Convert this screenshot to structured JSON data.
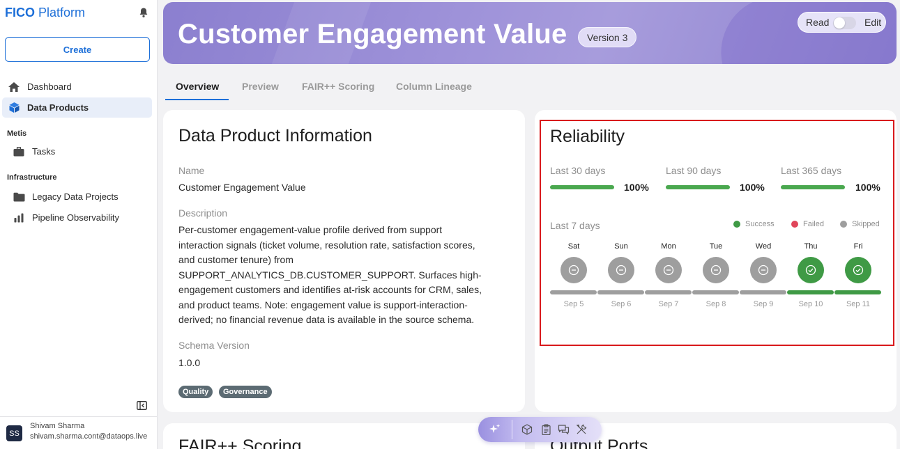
{
  "sidebar": {
    "brand_bold": "FICO",
    "brand_rest": "Platform",
    "create_label": "Create",
    "items": [
      {
        "label": "Dashboard",
        "icon": "home-icon"
      },
      {
        "label": "Data Products",
        "icon": "cube-icon"
      }
    ],
    "sections": [
      {
        "title": "Metis",
        "items": [
          {
            "label": "Tasks",
            "icon": "briefcase-icon"
          }
        ]
      },
      {
        "title": "Infrastructure",
        "items": [
          {
            "label": "Legacy Data Projects",
            "icon": "folder-icon"
          },
          {
            "label": "Pipeline Observability",
            "icon": "bar-chart-icon"
          }
        ]
      }
    ],
    "user": {
      "initials": "SS",
      "name": "Shivam Sharma",
      "email": "shivam.sharma.cont@dataops.live"
    }
  },
  "header": {
    "title": "Customer Engagement Value",
    "version": "Version 3",
    "mode_read": "Read",
    "mode_edit": "Edit"
  },
  "tabs": [
    {
      "label": "Overview"
    },
    {
      "label": "Preview"
    },
    {
      "label": "FAIR++ Scoring"
    },
    {
      "label": "Column Lineage"
    }
  ],
  "info": {
    "title": "Data Product Information",
    "name_label": "Name",
    "name_value": "Customer Engagement Value",
    "description_label": "Description",
    "description_lines": [
      "Per-customer engagement-value profile derived from support",
      "interaction signals (ticket volume, resolution rate, satisfaction scores,",
      "and customer tenure) from",
      "SUPPORT_ANALYTICS_DB.CUSTOMER_SUPPORT. Surfaces high-",
      "engagement customers and identifies at-risk accounts for CRM, sales,",
      "and product teams. Note: engagement value is support-interaction-",
      "derived; no financial revenue data is available in the source schema."
    ],
    "schema_label": "Schema Version",
    "schema_value": "1.0.0",
    "tags": [
      "Quality",
      "Governance"
    ]
  },
  "reliability": {
    "title": "Reliability",
    "periods": [
      {
        "label": "Last 30 days",
        "pct": "100%",
        "value": 1.0
      },
      {
        "label": "Last 90 days",
        "pct": "100%",
        "value": 1.0
      },
      {
        "label": "Last 365 days",
        "pct": "100%",
        "value": 1.0
      }
    ],
    "last7_label": "Last 7 days",
    "legend": [
      {
        "label": "Success",
        "color": "#3f9a45"
      },
      {
        "label": "Failed",
        "color": "#e0455a"
      },
      {
        "label": "Skipped",
        "color": "#9e9e9e"
      }
    ],
    "days": [
      {
        "name": "Sat",
        "date": "Sep 5",
        "status": "skipped"
      },
      {
        "name": "Sun",
        "date": "Sep 6",
        "status": "skipped"
      },
      {
        "name": "Mon",
        "date": "Sep 7",
        "status": "skipped"
      },
      {
        "name": "Tue",
        "date": "Sep 8",
        "status": "skipped"
      },
      {
        "name": "Wed",
        "date": "Sep 9",
        "status": "skipped"
      },
      {
        "name": "Thu",
        "date": "Sep 10",
        "status": "success"
      },
      {
        "name": "Fri",
        "date": "Sep 11",
        "status": "success"
      }
    ]
  },
  "bottom": {
    "left_title": "FAIR++ Scoring",
    "right_title": "Output Ports"
  },
  "toolbar": {
    "icons": [
      "sparkle-icon",
      "cube-outline-icon",
      "clipboard-icon",
      "chat-icon",
      "tools-icon"
    ]
  },
  "colors": {
    "accent": "#1d6fd8",
    "success": "#3f9a45",
    "skipped": "#9e9e9e",
    "banner": "#9b8fd6",
    "highlight": "#d9191c"
  }
}
